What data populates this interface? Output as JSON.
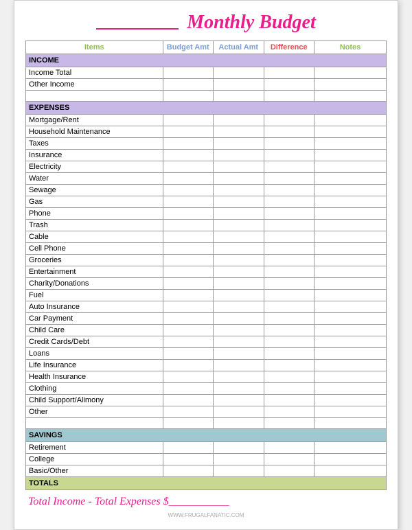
{
  "header": {
    "title": "Monthly Budget",
    "underline_label": "___________"
  },
  "columns": {
    "items": "Items",
    "budget_amt": "Budget Amt",
    "actual_amt": "Actual Amt",
    "difference": "Difference",
    "notes": "Notes"
  },
  "sections": {
    "income": {
      "label": "INCOME",
      "rows": [
        "Income Total",
        "Other Income",
        ""
      ]
    },
    "expenses": {
      "label": "EXPENSES",
      "rows": [
        "Mortgage/Rent",
        "Household Maintenance",
        "Taxes",
        "Insurance",
        "Electricity",
        "Water",
        "Sewage",
        "Gas",
        "Phone",
        "Trash",
        "Cable",
        "Cell Phone",
        "Groceries",
        "Entertainment",
        "Charity/Donations",
        "Fuel",
        "Auto Insurance",
        "Car Payment",
        "Child Care",
        "Credit Cards/Debt",
        "Loans",
        "Life Insurance",
        "Health Insurance",
        "Clothing",
        "Child Support/Alimony",
        "Other",
        ""
      ]
    },
    "savings": {
      "label": "SAVINGS",
      "rows": [
        "Retirement",
        "College",
        "Basic/Other"
      ]
    },
    "totals": {
      "label": "TOTALS"
    }
  },
  "footer": {
    "formula": "Total Income - Total Expenses $___________"
  },
  "watermark": "WWW.FRUGALFANATIC.COM"
}
